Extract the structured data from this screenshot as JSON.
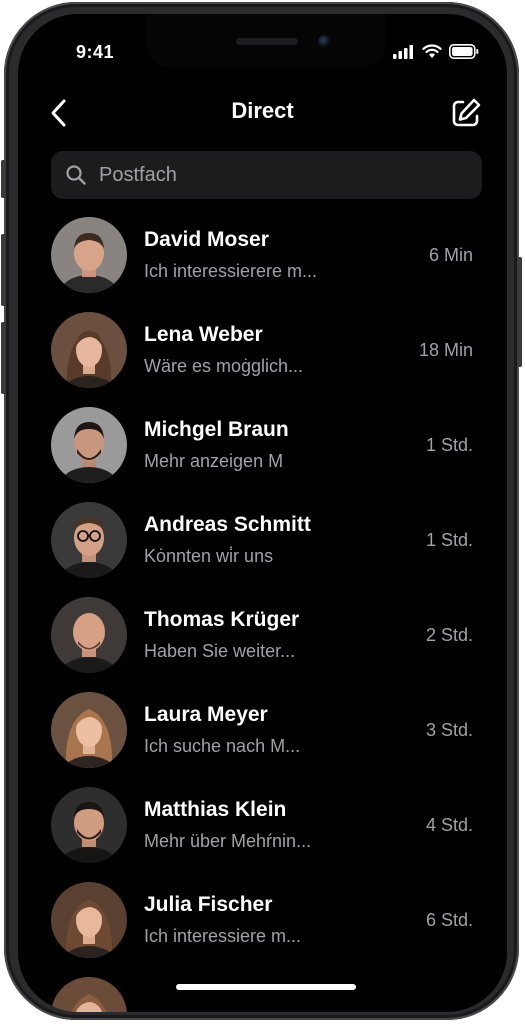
{
  "status_bar": {
    "time": "9:41"
  },
  "header": {
    "title": "Direct",
    "back_icon": "chevron-left-icon",
    "compose_icon": "compose-icon"
  },
  "search": {
    "placeholder": "Postfach",
    "icon": "search-icon"
  },
  "conversations": [
    {
      "name": "David Moser",
      "preview": "Ich interessierere m...",
      "time": "6 Min",
      "avatar_color": "#8a8480"
    },
    {
      "name": "Lena Weber",
      "preview": "Wäre es moġglich...",
      "time": "18 Min",
      "avatar_color": "#6b4f3f"
    },
    {
      "name": "Michgel Braun",
      "preview": "Mehr anzeigen M",
      "time": "1 Std.",
      "avatar_color": "#9a9a9a"
    },
    {
      "name": "Andreas Schmitt",
      "preview": "Kȯnnten wi̇r uns",
      "time": "1 Std.",
      "avatar_color": "#3a3a3a"
    },
    {
      "name": "Thomas Krüger",
      "preview": "Haben Sie weiter...",
      "time": "2 Std.",
      "avatar_color": "#3f3a38"
    },
    {
      "name": "Laura Meyer",
      "preview": "Ich suche nach M...",
      "time": "3 Std.",
      "avatar_color": "#6a5140"
    },
    {
      "name": "Matthias Klein",
      "preview": "Mehr über Mehŕnin...",
      "time": "4 Std.",
      "avatar_color": "#2e2e2e"
    },
    {
      "name": "Julia Fischer",
      "preview": "Ich interessiere m...",
      "time": "6 Std.",
      "avatar_color": "#5a4030"
    }
  ],
  "colors": {
    "background": "#000000",
    "search_bg": "#1c1c1e",
    "primary_text": "#ffffff",
    "secondary_text": "#a1a1a6"
  }
}
